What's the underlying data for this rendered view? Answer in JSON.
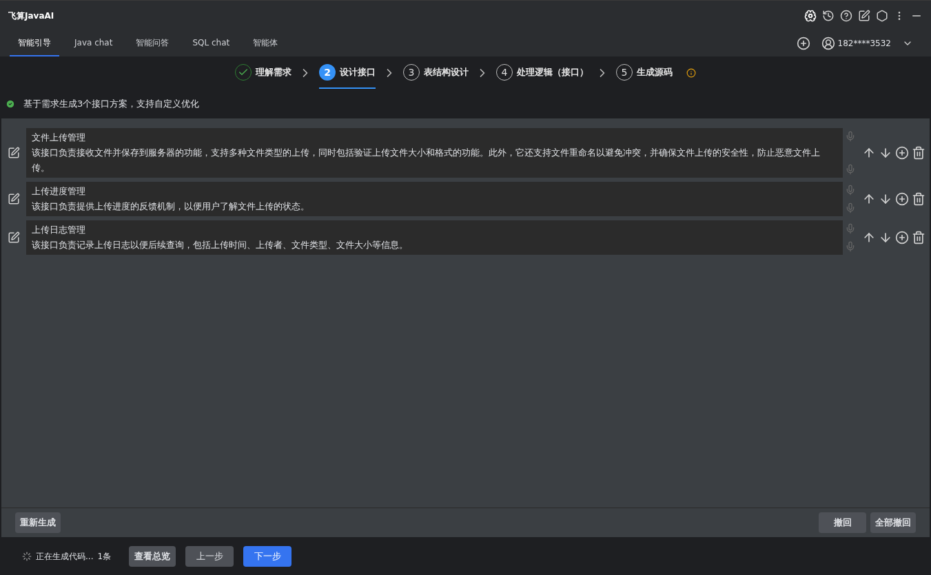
{
  "window": {
    "title": "飞算JavaAI"
  },
  "tabs": [
    {
      "label": "智能引导",
      "selected": true
    },
    {
      "label": "Java chat",
      "selected": false
    },
    {
      "label": "智能问答",
      "selected": false
    },
    {
      "label": "SQL chat",
      "selected": false
    },
    {
      "label": "智能体",
      "selected": false
    }
  ],
  "user": {
    "name": "182****3532"
  },
  "steps": [
    {
      "label": "理解需求",
      "done": true,
      "selected": false
    },
    {
      "number": "2",
      "label": "设计接口",
      "done": false,
      "selected": true
    },
    {
      "number": "3",
      "label": "表结构设计",
      "done": false,
      "selected": false
    },
    {
      "number": "4",
      "label": "处理逻辑（接口）",
      "done": false,
      "selected": false
    },
    {
      "number": "5",
      "label": "生成源码",
      "done": false,
      "selected": false
    }
  ],
  "info": {
    "text": "基于需求生成3个接口方案，支持自定义优化"
  },
  "interfaces": [
    {
      "title": "文件上传管理",
      "description": "该接口负责接收文件并保存到服务器的功能，支持多种文件类型的上传，同时包括验证上传文件大小和格式的功能。此外，它还支持文件重命名以避免冲突，并确保文件上传的安全性，防止恶意文件上传。"
    },
    {
      "title": "上传进度管理",
      "description": "该接口负责提供上传进度的反馈机制，以便用户了解文件上传的状态。"
    },
    {
      "title": "上传日志管理",
      "description": "该接口负责记录上传日志以便后续查询，包括上传时间、上传者、文件类型、文件大小等信息。"
    }
  ],
  "actions": {
    "regenerate": "重新生成",
    "undo": "撤回",
    "undo_all": "全部撤回"
  },
  "footer": {
    "status": "正在生成代码...",
    "count": "1条",
    "overview": "查看总览",
    "prev": "上一步",
    "next": "下一步"
  }
}
